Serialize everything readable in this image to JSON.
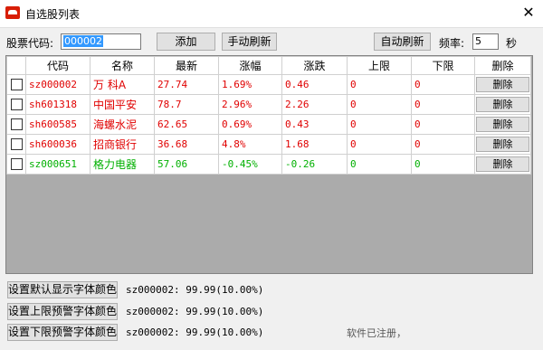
{
  "window": {
    "title": "自选股列表",
    "close_glyph": "✕"
  },
  "toolbar": {
    "code_label": "股票代码:",
    "code_value": "000002",
    "add_label": "添加",
    "manual_refresh_label": "手动刷新",
    "auto_refresh_label": "自动刷新",
    "freq_label": "频率:",
    "freq_value": "5",
    "freq_unit": "秒"
  },
  "table": {
    "columns": [
      "代码",
      "名称",
      "最新",
      "涨幅",
      "涨跌",
      "上限",
      "下限",
      "删除"
    ],
    "delete_label": "删除",
    "rows": [
      {
        "code": "sz000002",
        "name": "万 科A",
        "latest": "27.74",
        "change_pct": "1.69%",
        "change": "0.46",
        "upper": "0",
        "lower": "0",
        "color": "#e00000"
      },
      {
        "code": "sh601318",
        "name": "中国平安",
        "latest": "78.7",
        "change_pct": "2.96%",
        "change": "2.26",
        "upper": "0",
        "lower": "0",
        "color": "#e00000"
      },
      {
        "code": "sh600585",
        "name": "海螺水泥",
        "latest": "62.65",
        "change_pct": "0.69%",
        "change": "0.43",
        "upper": "0",
        "lower": "0",
        "color": "#e00000"
      },
      {
        "code": "sh600036",
        "name": "招商银行",
        "latest": "36.68",
        "change_pct": "4.8%",
        "change": "1.68",
        "upper": "0",
        "lower": "0",
        "color": "#e00000"
      },
      {
        "code": "sz000651",
        "name": "格力电器",
        "latest": "57.06",
        "change_pct": "-0.45%",
        "change": "-0.26",
        "upper": "0",
        "lower": "0",
        "color": "#00b000"
      }
    ]
  },
  "bottom": {
    "default_font_btn": "设置默认显示字体颜色",
    "upper_font_btn": "设置上限预警字体颜色",
    "lower_font_btn": "设置下限预警字体颜色",
    "default_sample": "sz000002: 99.99(10.00%)",
    "upper_sample": "sz000002: 99.99(10.00%)",
    "lower_sample": "sz000002: 99.99(10.00%)",
    "registered_note": "软件已注册，"
  }
}
